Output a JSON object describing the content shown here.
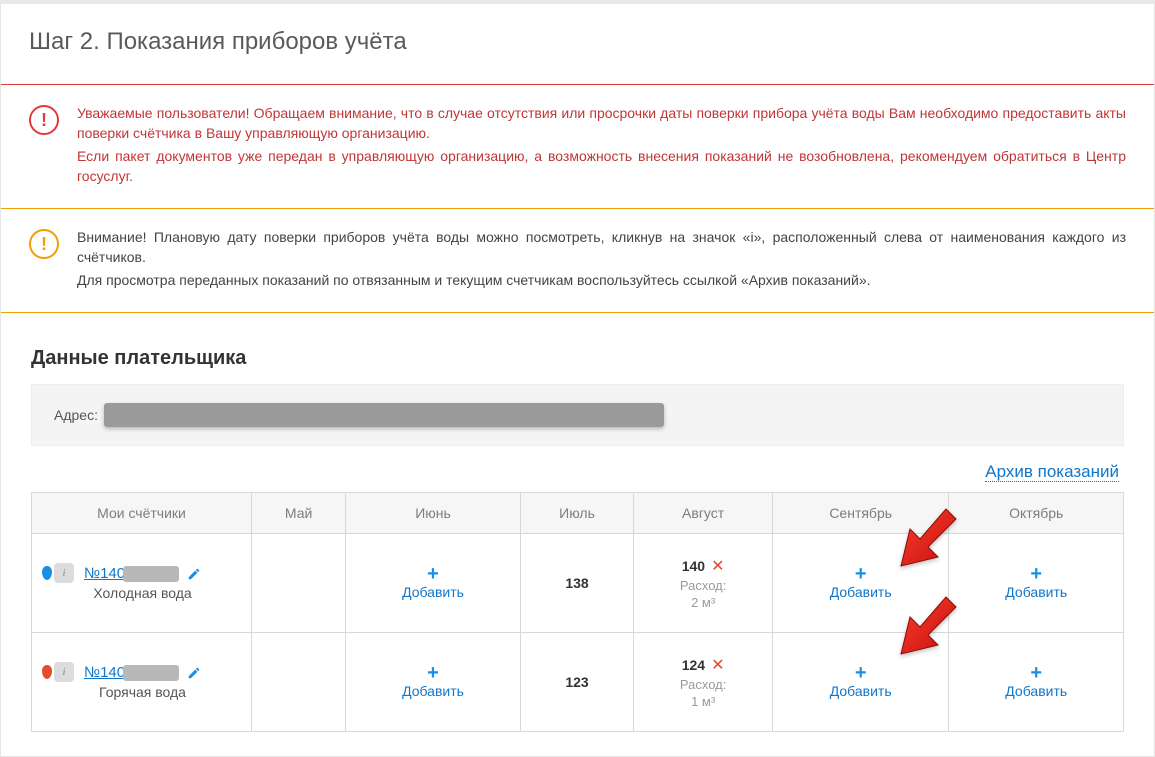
{
  "title": "Шаг 2. Показания приборов учёта",
  "alerts": {
    "red": {
      "line1": "Уважаемые пользователи! Обращаем внимание, что в случае отсутствия или просрочки даты поверки прибора учёта воды Вам необходимо предоставить акты поверки счётчика в Вашу управляющую организацию.",
      "line2": "Если пакет документов уже передан в управляющую организацию, а возможность внесения показаний не возобновлена, рекомендуем обратиться в Центр госуслуг."
    },
    "orange": {
      "line1": "Внимание! Плановую дату поверки приборов учёта воды можно посмотреть, кликнув на значок «i», расположенный слева от наименования каждого из счётчиков.",
      "line2": "Для просмотра переданных показаний по отвязанным и текущим счетчикам воспользуйтесь ссылкой «Архив показаний»."
    }
  },
  "payer_section": {
    "header": "Данные плательщика",
    "address_label": "Адрес:"
  },
  "archive_link": "Архив показаний",
  "table": {
    "headers": {
      "meters": "Мои счётчики",
      "may": "Май",
      "june": "Июнь",
      "july": "Июль",
      "august": "Август",
      "september": "Сентябрь",
      "october": "Октябрь"
    },
    "add_label": "Добавить",
    "rows": [
      {
        "prefix": "№140",
        "type": "Холодная вода",
        "july": "138",
        "aug_value": "140",
        "aug_sub1": "Расход:",
        "aug_sub2": "2 м³"
      },
      {
        "prefix": "№140",
        "type": "Горячая вода",
        "july": "123",
        "aug_value": "124",
        "aug_sub1": "Расход:",
        "aug_sub2": "1 м³"
      }
    ]
  }
}
